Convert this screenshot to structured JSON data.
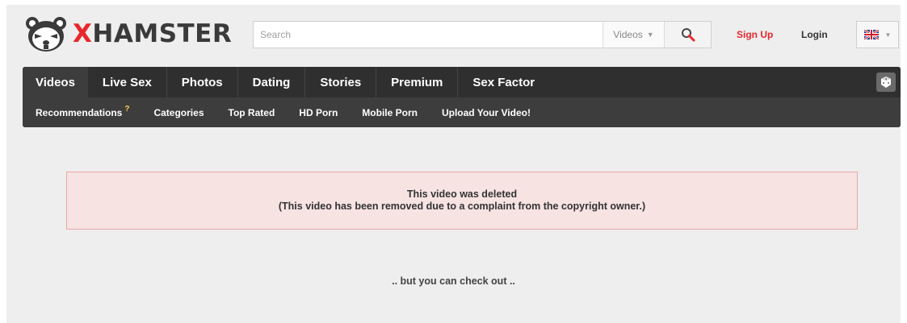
{
  "header": {
    "logo": {
      "brand_first_letter": "X",
      "brand_rest": "HAMSTER",
      "icon": "hamster-logo-icon"
    },
    "search": {
      "placeholder": "Search",
      "scope": "Videos",
      "button_icon": "search-icon"
    },
    "signup_label": "Sign Up",
    "login_label": "Login",
    "language_icon": "uk-flag-icon"
  },
  "nav": {
    "tabs": [
      {
        "label": "Videos",
        "active": true
      },
      {
        "label": "Live Sex"
      },
      {
        "label": "Photos"
      },
      {
        "label": "Dating"
      },
      {
        "label": "Stories"
      },
      {
        "label": "Premium"
      },
      {
        "label": "Sex Factor"
      }
    ],
    "random_icon": "dice-icon",
    "subnav": [
      {
        "label": "Recommendations"
      },
      {
        "label": "Categories"
      },
      {
        "label": "Top Rated"
      },
      {
        "label": "HD Porn"
      },
      {
        "label": "Mobile Porn"
      },
      {
        "label": "Upload Your Video!"
      }
    ]
  },
  "alert": {
    "title": "This video was deleted",
    "message": "(This video has been removed due to a complaint from the copyright owner.)"
  },
  "checkout_text": ".. but you can check out ..",
  "colors": {
    "brand_red": "#e8272c",
    "nav_dark": "#2f2f2f",
    "alert_bg": "#f6e3e2",
    "alert_border": "#e8a8a6"
  }
}
